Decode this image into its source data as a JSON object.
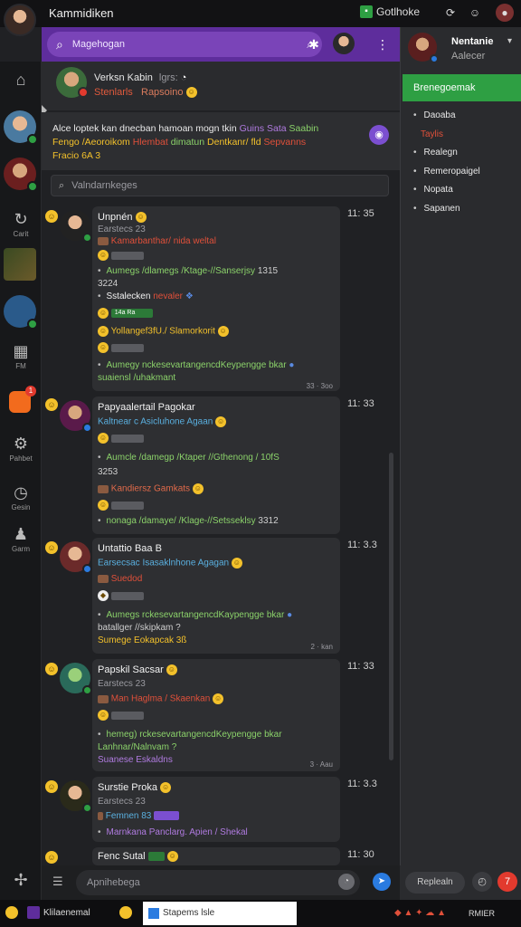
{
  "window": {
    "title": "Kammidiken",
    "extension_label": "Gotlhoke"
  },
  "header": {
    "search_placeholder": "Magehogan",
    "search_key": "⌕"
  },
  "conversation": {
    "name": "Verksn Kabin",
    "name_suffix": "lgrs:",
    "sub_left": "Stenlarls",
    "sub_right": "Rapsoino"
  },
  "banner": {
    "line1_a": "Alce loptek kan dnecban hamoan mogn tkin",
    "line1_b": "Guins Sata",
    "line1_c": "Saabin",
    "line2_a": "Fengo /Aeoroikom",
    "line2_b": "Hlembat",
    "line2_c": "dimatun",
    "line2_d": "Dentkanr/ fld",
    "line2_e": "Sepvanns",
    "line3": "Fracio 6A 3"
  },
  "filter": {
    "placeholder": "Valndarnkeges"
  },
  "left_rail": {
    "items": [
      {
        "label": "Carit",
        "icon": "refresh-icon"
      },
      {
        "label": "FM",
        "icon": "grid-icon"
      },
      {
        "label": "Pahbet",
        "icon": "gear-icon"
      },
      {
        "label": "Gesin",
        "icon": "history-icon"
      },
      {
        "label": "Garm",
        "icon": "person-icon"
      }
    ]
  },
  "messages": [
    {
      "name": "Unpnén",
      "time": "11: 35",
      "lines": [
        {
          "text": "Earstecs 23",
          "color": "#9a9aa0"
        },
        {
          "text": "Kamarbanthar/ nida weltal",
          "color": "#e0503a"
        },
        {
          "text": "Aumegs /dlamegs /Ktage-//Sanserjsy",
          "color": "#8bd26a",
          "extra": "1315"
        },
        {
          "text": "3224",
          "color": "#cfcfcf"
        },
        {
          "text": "Sstalecken",
          "color": "#f2f2f2",
          "extra": "nevaler"
        },
        {
          "text": "Yollangef3fU./ Slamorkorit",
          "color": "#f3c12b"
        },
        {
          "text": "Aumegy nckesevartangencdKeypengge bkar",
          "color": "#8bd26a"
        },
        {
          "text": "suaiensl /uhakmant",
          "color": "#8bd26a"
        }
      ],
      "chip_green": "14a Ra",
      "footer": "33 · 3oo"
    },
    {
      "name": "Papyaalertail Pagokar",
      "time": "11: 33",
      "lines": [
        {
          "text": "Kaltnear c Asicluhone Agaan",
          "color": "#5ab0e0"
        },
        {
          "text": "Aumcle /damegp /Ktaper //Gthenong / 10fS",
          "color": "#8bd26a"
        },
        {
          "text": "3253",
          "color": "#cfcfcf"
        },
        {
          "text": "Kandiersz Gamkats",
          "color": "#e06a4a"
        },
        {
          "text": "nonaga /damaye/ /Klage-//Setsseklsy",
          "color": "#8bd26a",
          "extra": "3312"
        }
      ]
    },
    {
      "name": "Untattio Baa B",
      "time": "11: 3.3",
      "lines": [
        {
          "text": "Earsecsac Isasaklnhone Agagan",
          "color": "#5ab0e0"
        },
        {
          "text": "Suedod",
          "color": "#e0503a"
        },
        {
          "text": "Aumegs rckesevartangencdKaypengge bkar",
          "color": "#8bd26a"
        },
        {
          "text": "batallger //skipkam ?",
          "color": "#cfcfcf"
        },
        {
          "text": "Sumege Eokapcak 3ß",
          "color": "#f3c12b"
        }
      ],
      "footer": "2 · kan"
    },
    {
      "name": "Papskil Sacsar",
      "time": "11: 33",
      "lines": [
        {
          "text": "Earstecs 23",
          "color": "#9a9aa0"
        },
        {
          "text": "Man Haglma / Skaenkan",
          "color": "#e0503a"
        },
        {
          "text": "hemeg) rckesevartangencdKeypengge bkar",
          "color": "#8bd26a"
        },
        {
          "text": "Lanhnar/Nalnvam ?",
          "color": "#8bd26a"
        },
        {
          "text": "Suanese Eskaldns",
          "color": "#b07be0"
        }
      ],
      "footer": "3 · Aau"
    },
    {
      "name": "Surstie Proka",
      "time": "11: 3.3",
      "lines": [
        {
          "text": "Earstecs 23",
          "color": "#9a9aa0"
        },
        {
          "text": "Femnen 83",
          "color": "#5ab0e0"
        },
        {
          "text": "Marnkana Panclarg. Apien / Shekal",
          "color": "#b07be0"
        }
      ]
    },
    {
      "name": "Fenc Sutal",
      "time": "11: 30",
      "lines": []
    }
  ],
  "composer": {
    "placeholder": "Apnihebega"
  },
  "right_panel": {
    "profile_name": "Nentanie",
    "profile_status": "Aalecer",
    "section_button": "Brenegoemak",
    "items": [
      {
        "label": "Daoaba",
        "hot": false
      },
      {
        "label": "Taylis",
        "hot": true
      },
      {
        "label": "Realegn",
        "hot": false
      },
      {
        "label": "Remeropaigel",
        "hot": false
      },
      {
        "label": "Nopata",
        "hot": false
      },
      {
        "label": "Sapanen",
        "hot": false
      }
    ],
    "action_button": "Replealn"
  },
  "taskbar": {
    "item1": "Klilaenemal",
    "active_item": "Stapems lsle",
    "tray": "RMIER"
  },
  "colors": {
    "accent_purple": "#5e2d9c",
    "green": "#2e9f43",
    "red": "#e23a2e"
  }
}
